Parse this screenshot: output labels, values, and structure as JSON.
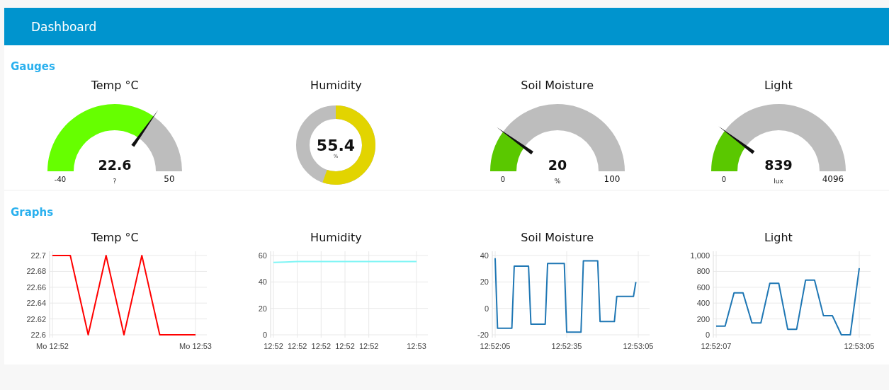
{
  "header": {
    "title": "Dashboard"
  },
  "sections": [
    {
      "title": "Gauges",
      "gauges": [
        {
          "kind": "gauge",
          "title": "Temp °C",
          "value": "22.6",
          "units": "?",
          "min": "-40",
          "max": "50",
          "level": 0.696,
          "color": "#66ff00"
        },
        {
          "kind": "donut",
          "title": "Humidity",
          "value": "55.4",
          "units": "%",
          "level": 0.554,
          "color": "#e2d400"
        },
        {
          "kind": "gauge",
          "title": "Soil Moisture",
          "value": "20",
          "units": "%",
          "min": "0",
          "max": "100",
          "level": 0.2,
          "color": "#5ac800"
        },
        {
          "kind": "gauge",
          "title": "Light",
          "value": "839",
          "units": "lux",
          "min": "0",
          "max": "4096",
          "level": 0.205,
          "color": "#5ac800"
        }
      ]
    },
    {
      "title": "Graphs",
      "charts": [
        {
          "chart_data": {
            "type": "line",
            "title": "Temp °C",
            "grid": true,
            "ylim": [
              22.6,
              22.7
            ],
            "yticks": [
              22.6,
              22.62,
              22.64,
              22.66,
              22.68,
              22.7
            ],
            "categories": [
              "Mo 12:52",
              null,
              null,
              null,
              null,
              null,
              null,
              null,
              "Mo 12:53"
            ],
            "series": [
              {
                "color": "#ff0000",
                "values": [
                  22.7,
                  22.7,
                  22.6,
                  22.7,
                  22.6,
                  22.7,
                  22.6,
                  22.6,
                  22.6
                ]
              }
            ]
          }
        },
        {
          "chart_data": {
            "type": "line",
            "title": "Humidity",
            "grid": true,
            "ylim": [
              0,
              60
            ],
            "yticks": [
              0,
              20,
              40,
              60
            ],
            "categories": [
              "12:52",
              null,
              "12:52",
              null,
              "12:52",
              null,
              "12:52",
              null,
              "12:52",
              null,
              null,
              null,
              "12:53"
            ],
            "series": [
              {
                "color": "#7ff5f5",
                "values": [
                  54.8,
                  55.1,
                  55.4,
                  55.4,
                  55.4,
                  55.4,
                  55.4,
                  55.4,
                  55.4,
                  55.4,
                  55.4,
                  55.4,
                  55.4
                ]
              }
            ]
          }
        },
        {
          "chart_data": {
            "type": "line",
            "title": "Soil Moisture",
            "grid": true,
            "ylim": [
              -20,
              40
            ],
            "yticks": [
              -20,
              0,
              20,
              40
            ],
            "categories": [
              "12:52:05",
              null,
              null,
              null,
              null,
              null,
              null,
              null,
              null,
              null,
              null,
              null,
              null,
              null,
              null,
              null,
              null,
              null,
              null,
              null,
              null,
              null,
              null,
              null,
              null,
              null,
              null,
              null,
              null,
              null,
              "12:52:35",
              null,
              null,
              null,
              null,
              null,
              null,
              null,
              null,
              null,
              null,
              null,
              null,
              null,
              null,
              null,
              null,
              null,
              null,
              null,
              null,
              null,
              null,
              null,
              null,
              null,
              null,
              null,
              null,
              null,
              "12:53:05"
            ],
            "series": [
              {
                "color": "#1f77b4",
                "values": [
                  38,
                  -15,
                  -15,
                  -15,
                  -15,
                  -15,
                  -15,
                  -15,
                  32,
                  32,
                  32,
                  32,
                  32,
                  32,
                  32,
                  -12,
                  -12,
                  -12,
                  -12,
                  -12,
                  -12,
                  -12,
                  34,
                  34,
                  34,
                  34,
                  34,
                  34,
                  34,
                  34,
                  -18,
                  -18,
                  -18,
                  -18,
                  -18,
                  -18,
                  -18,
                  36,
                  36,
                  36,
                  36,
                  36,
                  36,
                  36,
                  -10,
                  -10,
                  -10,
                  -10,
                  -10,
                  -10,
                  -10,
                  9,
                  9,
                  9,
                  9,
                  9,
                  9,
                  9,
                  9,
                  20,
                  null
                ]
              }
            ]
          }
        },
        {
          "chart_data": {
            "type": "line",
            "title": "Light",
            "grid": true,
            "ylim": [
              0,
              1000
            ],
            "yticks": [
              0,
              200,
              400,
              600,
              800,
              {
                "value": 1000,
                "label": "1,000"
              }
            ],
            "categories": [
              "12:52:07",
              null,
              null,
              null,
              null,
              null,
              null,
              null,
              null,
              null,
              null,
              null,
              null,
              null,
              null,
              null,
              "12:53:05"
            ],
            "series": [
              {
                "color": "#1f77b4",
                "values": [
                  110,
                  110,
                  530,
                  530,
                  150,
                  150,
                  650,
                  650,
                  70,
                  70,
                  690,
                  690,
                  240,
                  240,
                  0,
                  0,
                  840
                ]
              }
            ]
          }
        }
      ]
    }
  ]
}
